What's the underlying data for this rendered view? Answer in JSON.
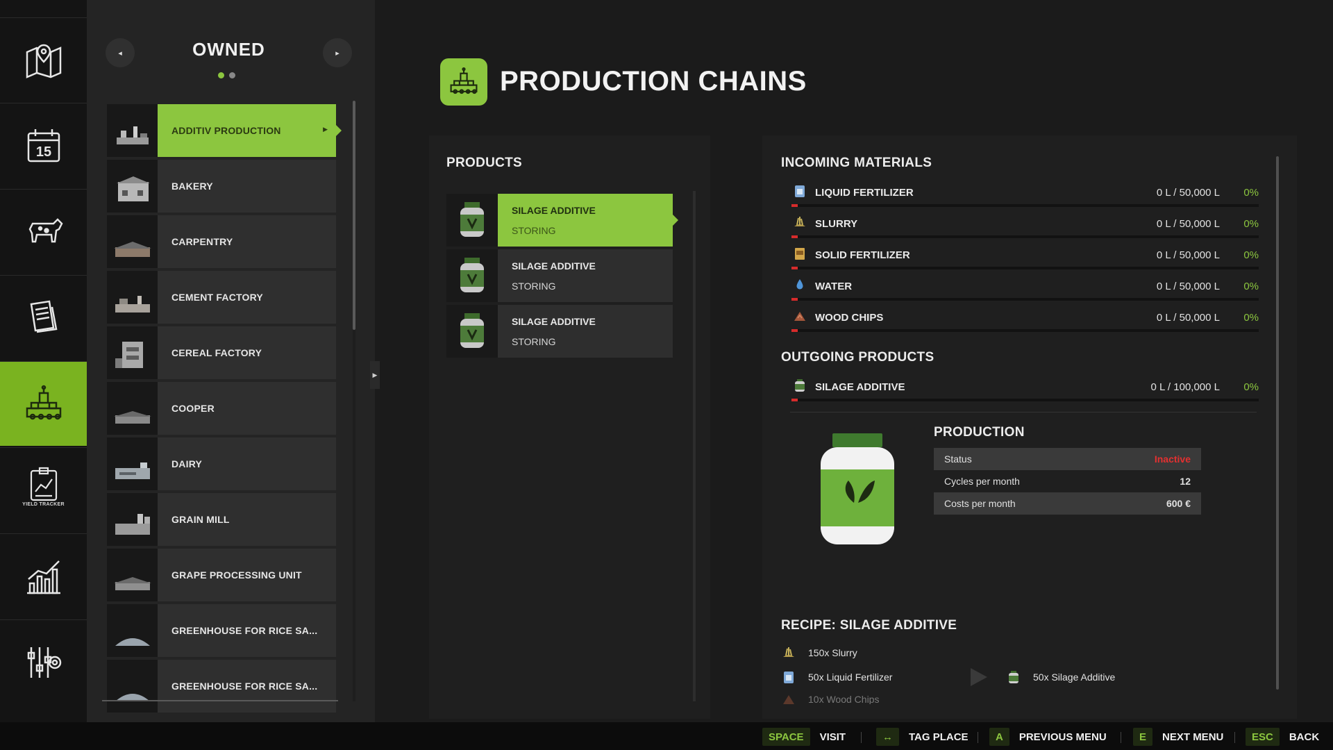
{
  "sidebar": {
    "items": [
      {
        "name": "map-icon",
        "active": false
      },
      {
        "name": "calendar-icon",
        "label": "15",
        "active": false
      },
      {
        "name": "animals-icon",
        "active": false
      },
      {
        "name": "contracts-icon",
        "active": false
      },
      {
        "name": "production-icon",
        "active": true
      },
      {
        "name": "yield-tracker-icon",
        "caption": "YIELD TRACKER",
        "active": false
      },
      {
        "name": "statistics-icon",
        "active": false
      },
      {
        "name": "settings-icon",
        "active": false
      }
    ]
  },
  "owned": {
    "title": "OWNED",
    "prev_icon": "◂",
    "next_icon": "▸",
    "page_count": 2,
    "current_page": 1,
    "items": [
      {
        "label": "ADDITIV PRODUCTION",
        "selected": true
      },
      {
        "label": "BAKERY"
      },
      {
        "label": "CARPENTRY"
      },
      {
        "label": "CEMENT FACTORY"
      },
      {
        "label": "CEREAL FACTORY"
      },
      {
        "label": "COOPER"
      },
      {
        "label": "DAIRY"
      },
      {
        "label": "GRAIN MILL"
      },
      {
        "label": "GRAPE PROCESSING UNIT"
      },
      {
        "label": "GREENHOUSE FOR RICE SA..."
      },
      {
        "label": "GREENHOUSE FOR RICE SA..."
      }
    ]
  },
  "page": {
    "title": "PRODUCTION CHAINS"
  },
  "products": {
    "heading": "PRODUCTS",
    "items": [
      {
        "name": "SILAGE ADDITIVE",
        "state": "STORING",
        "selected": true
      },
      {
        "name": "SILAGE ADDITIVE",
        "state": "STORING"
      },
      {
        "name": "SILAGE ADDITIVE",
        "state": "STORING"
      }
    ]
  },
  "incoming": {
    "heading": "INCOMING MATERIALS",
    "items": [
      {
        "name": "LIQUID FERTILIZER",
        "amount": "0 L / 50,000 L",
        "percent": "0%",
        "fill": 0,
        "icon": "liquid-fertilizer-icon"
      },
      {
        "name": "SLURRY",
        "amount": "0 L / 50,000 L",
        "percent": "0%",
        "fill": 0,
        "icon": "slurry-icon"
      },
      {
        "name": "SOLID FERTILIZER",
        "amount": "0 L / 50,000 L",
        "percent": "0%",
        "fill": 0,
        "icon": "solid-fertilizer-icon"
      },
      {
        "name": "WATER",
        "amount": "0 L / 50,000 L",
        "percent": "0%",
        "fill": 0,
        "icon": "water-icon"
      },
      {
        "name": "WOOD CHIPS",
        "amount": "0 L / 50,000 L",
        "percent": "0%",
        "fill": 0,
        "icon": "wood-chips-icon"
      }
    ]
  },
  "outgoing": {
    "heading": "OUTGOING PRODUCTS",
    "items": [
      {
        "name": "SILAGE ADDITIVE",
        "amount": "0 L / 100,000 L",
        "percent": "0%",
        "fill": 0,
        "icon": "silage-additive-icon"
      }
    ]
  },
  "production": {
    "heading": "PRODUCTION",
    "rows": [
      {
        "label": "Status",
        "value": "Inactive",
        "status": "inactive"
      },
      {
        "label": "Cycles per month",
        "value": "12"
      },
      {
        "label": "Costs per month",
        "value": "600 €"
      }
    ]
  },
  "recipe": {
    "heading": "RECIPE: SILAGE ADDITIVE",
    "inputs": [
      "150x Slurry",
      "50x Liquid Fertilizer",
      "10x Wood Chips"
    ],
    "output": "50x Silage Additive"
  },
  "hints": [
    {
      "key": "SPACE",
      "label": "VISIT"
    },
    {
      "key": "↔",
      "label": "TAG PLACE"
    },
    {
      "key": "A",
      "label": "PREVIOUS MENU"
    },
    {
      "key": "E",
      "label": "NEXT MENU"
    },
    {
      "key": "ESC",
      "label": "BACK"
    }
  ],
  "colors": {
    "accent": "#8cc63f",
    "rail_active": "#7ab320",
    "status_inactive": "#e43030",
    "bar_empty": "#d62b2b"
  }
}
